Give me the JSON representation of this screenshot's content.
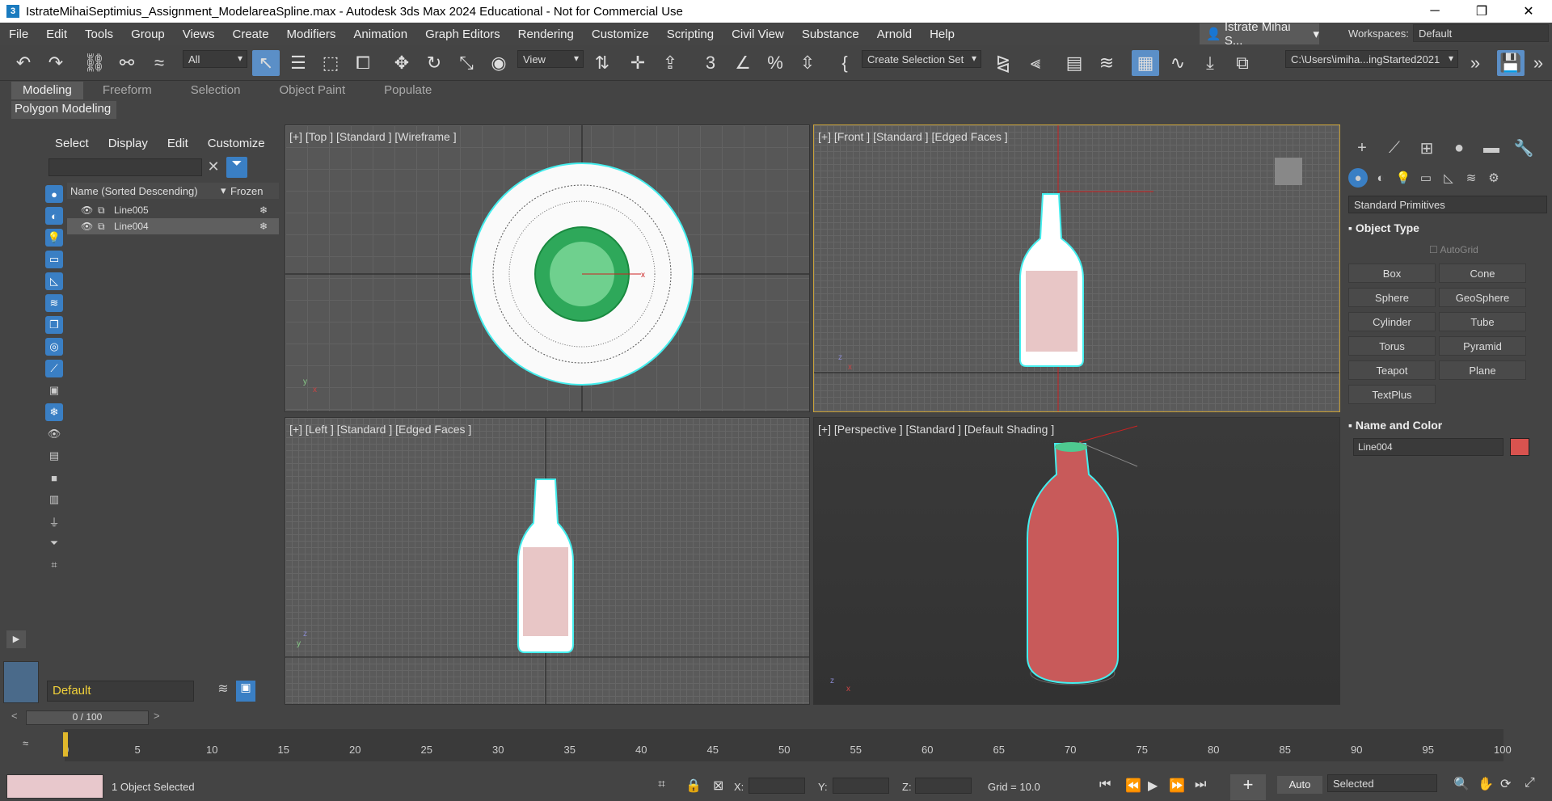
{
  "window": {
    "title": "IstrateMihaiSeptimius_Assignment_ModelareaSpline.max - Autodesk 3ds Max 2024 Educational - Not for Commercial Use",
    "app_icon": "3",
    "minimize": "─",
    "restore": "❐",
    "close": "✕"
  },
  "menu": [
    "File",
    "Edit",
    "Tools",
    "Group",
    "Views",
    "Create",
    "Modifiers",
    "Animation",
    "Graph Editors",
    "Rendering",
    "Customize",
    "Scripting",
    "Civil View",
    "Substance",
    "Arnold",
    "Help"
  ],
  "user": "Istrate Mihai S...",
  "workspaces": {
    "label": "Workspaces:",
    "value": "Default"
  },
  "toolbar": {
    "filter": "All",
    "refcoord": "View",
    "selset": "Create Selection Set",
    "path": "C:\\Users\\imiha...ingStarted2021"
  },
  "ribbon": {
    "tabs": [
      "Modeling",
      "Freeform",
      "Selection",
      "Object Paint",
      "Populate"
    ],
    "panel": "Polygon Modeling"
  },
  "explorer": {
    "menu": [
      "Select",
      "Display",
      "Edit",
      "Customize"
    ],
    "col_name": "Name (Sorted Descending)",
    "col_frozen": "Frozen",
    "rows": [
      {
        "name": "Line005"
      },
      {
        "name": "Line004"
      }
    ]
  },
  "layer": "Default",
  "viewports": {
    "top": "[+] [Top ] [Standard ] [Wireframe ]",
    "front": "[+] [Front ] [Standard ] [Edged Faces ]",
    "left": "[+] [Left ] [Standard ] [Edged Faces ]",
    "persp": "[+] [Perspective ] [Standard ] [Default Shading ]"
  },
  "cmd": {
    "category": "Standard Primitives",
    "object_type": "Object Type",
    "autogrid": "AutoGrid",
    "buttons": [
      "Box",
      "Cone",
      "Sphere",
      "GeoSphere",
      "Cylinder",
      "Tube",
      "Torus",
      "Pyramid",
      "Teapot",
      "Plane",
      "TextPlus"
    ],
    "name_color": "Name and Color",
    "name_value": "Line004",
    "color": "#d9534f"
  },
  "time": {
    "slider": "0 / 100",
    "ticks": [
      "0",
      "5",
      "10",
      "15",
      "20",
      "25",
      "30",
      "35",
      "40",
      "45",
      "50",
      "55",
      "60",
      "65",
      "70",
      "75",
      "80",
      "85",
      "90",
      "95",
      "100"
    ]
  },
  "status": {
    "selected": "1 Object Selected",
    "x": "X:",
    "y": "Y:",
    "z": "Z:",
    "grid": "Grid = 10.0",
    "auto": "Auto",
    "sel": "Selected"
  }
}
